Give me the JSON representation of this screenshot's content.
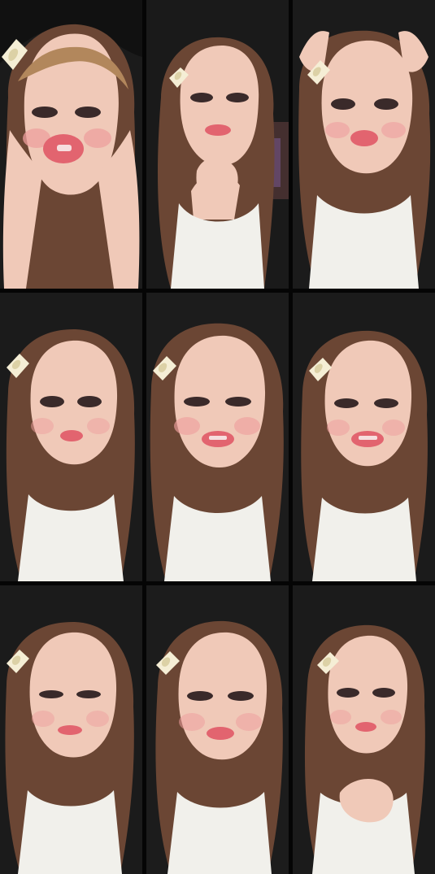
{
  "screenshot": {
    "description": "",
    "frames": [
      {
        "id": "frame-1"
      },
      {
        "id": "frame-2"
      },
      {
        "id": "frame-3"
      },
      {
        "id": "frame-4"
      },
      {
        "id": "frame-5"
      },
      {
        "id": "frame-6"
      },
      {
        "id": "frame-7"
      },
      {
        "id": "frame-8"
      },
      {
        "id": "frame-9"
      }
    ]
  },
  "colors": {
    "background": "#000000",
    "wall": "#1b1b1b",
    "hair": "#6b4634",
    "hair_light": "#b2875c",
    "skin": "#f0c9b8",
    "cheek": "#ee9f9e",
    "lips": "#e2646f",
    "top": "#f1f0eb",
    "clip": "#f5eed5"
  }
}
